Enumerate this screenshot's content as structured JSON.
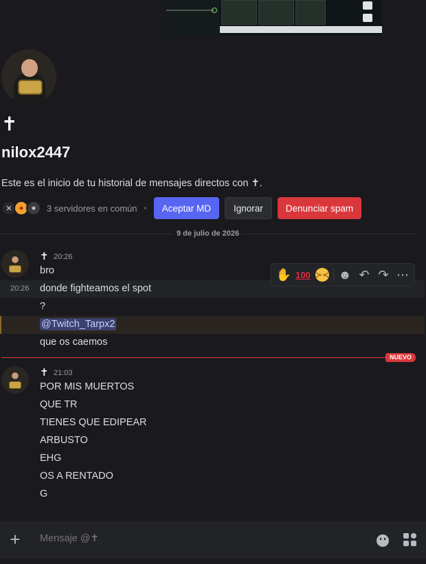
{
  "profile": {
    "display_name": "✝",
    "username": "nilox2447",
    "intro_text": "Este es el inicio de tu historial de mensajes directos con ✝.",
    "mutual_servers": "3 servidores en común"
  },
  "actions": {
    "accept": "Aceptar MD",
    "ignore": "Ignorar",
    "report": "Denunciar spam"
  },
  "date_divider": "9 de julio de 2026",
  "messages": [
    {
      "author": "✝",
      "time": "20:26",
      "lines": [
        "bro",
        "donde fighteamos el spot",
        "?",
        "@Twitch_Tarpx2",
        "que os caemos"
      ],
      "hover_time": "20:26"
    },
    {
      "author": "✝",
      "time": "21:03",
      "lines": [
        "POR MIS MUERTOS",
        "QUE TR",
        "TIENES QUE EDIPEAR",
        "ARBUSTO",
        "EHG",
        "OS A RENTADO",
        "G"
      ]
    }
  ],
  "new_badge": "NUEVO",
  "composer": {
    "placeholder": "Mensaje @✝"
  },
  "colors": {
    "background": "#1a1a1e",
    "accent": "#5865f2",
    "danger": "#da373c"
  }
}
